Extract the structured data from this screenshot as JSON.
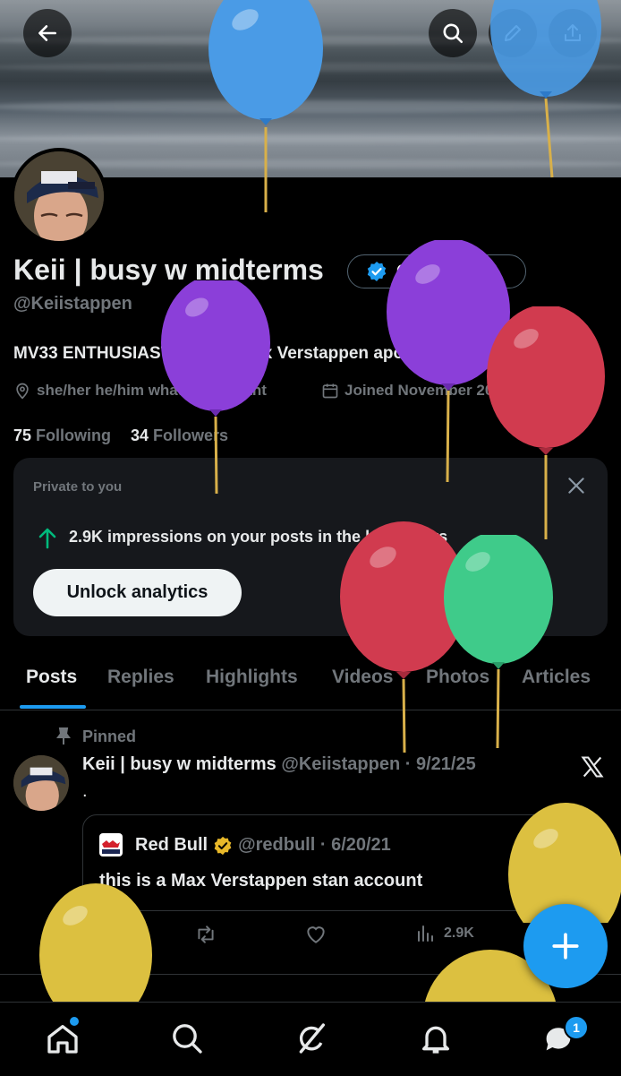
{
  "header": {
    "back": "back-arrow-icon",
    "search": "search-icon",
    "edit": "pencil-icon",
    "share": "share-icon"
  },
  "profile": {
    "name": "Keii | busy w midterms",
    "get_verified": "Get verified",
    "handle": "@Keiistappen",
    "bio": "MV33 ENTHUSIAST | Just a Max Verstappen apologist",
    "pronouns": "she/her he/him whatever u want",
    "joined": "Joined November 2024",
    "following_count": "75",
    "following_label": "Following",
    "followers_count": "34",
    "followers_label": "Followers"
  },
  "analytics_card": {
    "label": "Private to you",
    "impressions": "2.9K impressions on your posts in the last 7 days",
    "button": "Unlock analytics"
  },
  "tabs": [
    "Posts",
    "Replies",
    "Highlights",
    "Videos",
    "Photos",
    "Articles"
  ],
  "post": {
    "pinned": "Pinned",
    "author": "Keii | busy w midterms",
    "handle_date": "@Keiistappen · 9/21/25",
    "text": ".",
    "quote": {
      "author": "Red Bull",
      "handle_date": "@redbull · 6/20/21",
      "text": "this is a Max Verstappen stan account"
    },
    "views": "2.9K"
  },
  "bottom_nav": {
    "messages_badge": "1"
  },
  "colors": {
    "accent": "#1d9bf0",
    "verified_gold": "#e8b829",
    "impression_arrow": "#00ba7c"
  }
}
